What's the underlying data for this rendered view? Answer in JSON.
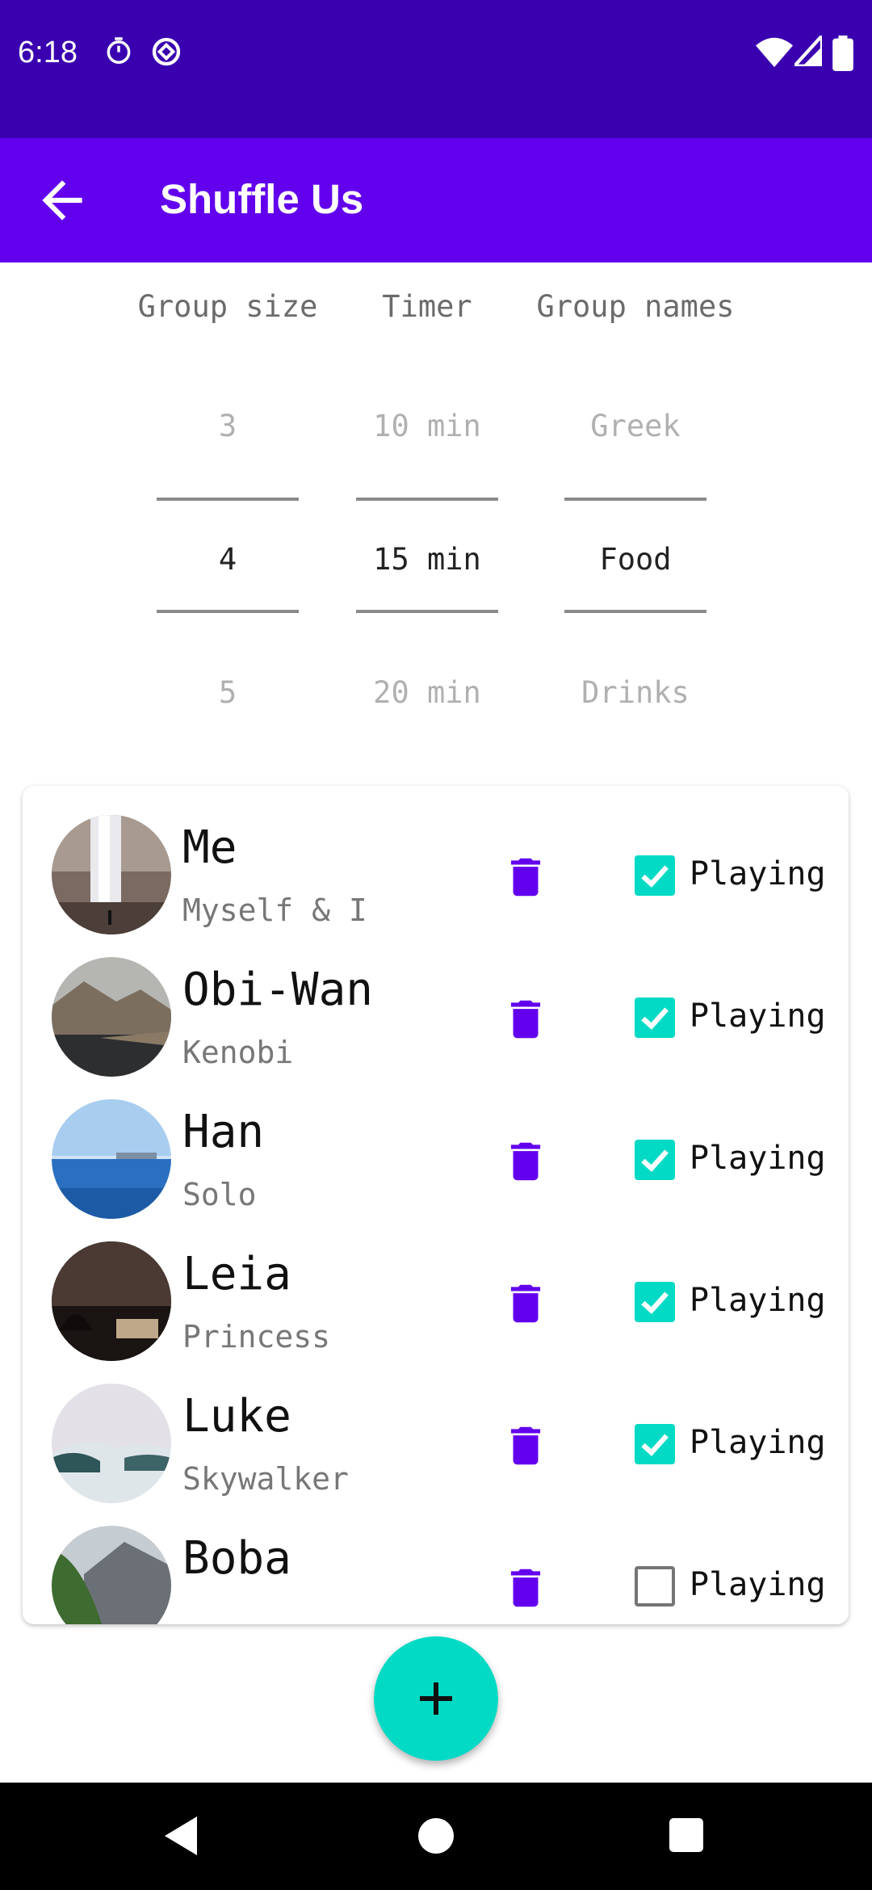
{
  "status_bar": {
    "time": "6:18",
    "icons_left": [
      "timer-icon",
      "data-saver-icon"
    ],
    "icons_right": [
      "wifi-icon",
      "signal-icon",
      "battery-icon"
    ]
  },
  "app_bar": {
    "title": "Shuffle Us",
    "back_icon": "arrow-back-icon"
  },
  "pickers": {
    "group_size": {
      "header": "Group size",
      "above": "3",
      "selected": "4",
      "below": "5"
    },
    "timer": {
      "header": "Timer",
      "above": "10 min",
      "selected": "15 min",
      "below": "20 min"
    },
    "group_names": {
      "header": "Group names",
      "above": "Greek",
      "selected": "Food",
      "below": "Drinks"
    }
  },
  "players": [
    {
      "name": "Me",
      "subtitle": "Myself & I",
      "playing": true,
      "label": "Playing"
    },
    {
      "name": "Obi-Wan",
      "subtitle": "Kenobi",
      "playing": true,
      "label": "Playing"
    },
    {
      "name": "Han",
      "subtitle": "Solo",
      "playing": true,
      "label": "Playing"
    },
    {
      "name": "Leia",
      "subtitle": "Princess",
      "playing": true,
      "label": "Playing"
    },
    {
      "name": "Luke",
      "subtitle": "Skywalker",
      "playing": true,
      "label": "Playing"
    },
    {
      "name": "Boba",
      "subtitle": "",
      "playing": false,
      "label": "Playing"
    }
  ],
  "colors": {
    "status_bar": "#3a00b0",
    "app_bar": "#6200ee",
    "accent": "#03dac5",
    "trash": "#6200ee"
  },
  "fab": {
    "icon": "plus-icon"
  },
  "nav": {
    "icons": [
      "back-triangle-icon",
      "home-circle-icon",
      "recents-square-icon"
    ]
  }
}
